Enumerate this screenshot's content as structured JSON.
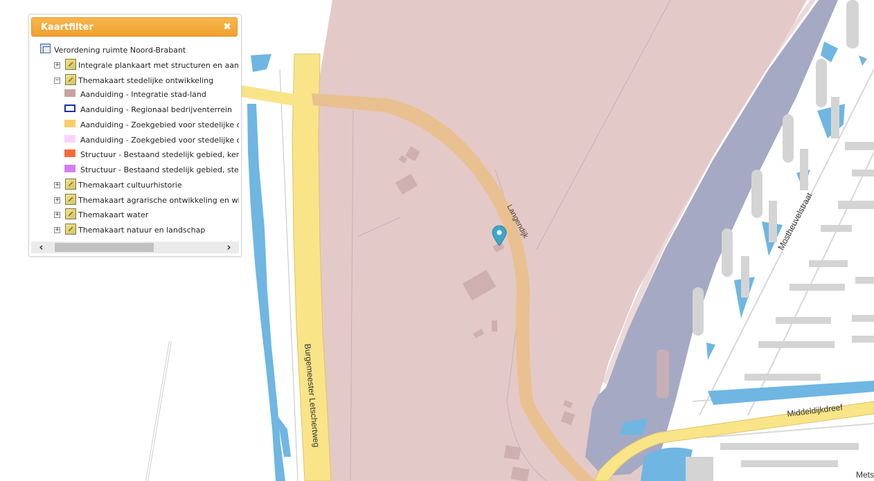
{
  "panel": {
    "title": "Kaartfilter",
    "close_glyph": "✖",
    "tree": {
      "root_label": "Verordening ruimte Noord-Brabant",
      "items": [
        {
          "label": "Integrale plankaart met structuren en aanduidingen",
          "expanded": false
        },
        {
          "label": "Themakaart stedelijke ontwikkeling",
          "expanded": true
        },
        {
          "label": "Themakaart cultuurhistorie",
          "expanded": false
        },
        {
          "label": "Themakaart agrarische ontwikkeling en windturbines",
          "expanded": false
        },
        {
          "label": "Themakaart water",
          "expanded": false
        },
        {
          "label": "Themakaart natuur en landschap",
          "expanded": false
        }
      ],
      "legend": [
        {
          "label": "Aanduiding - Integratie stad-land",
          "fill": "#c9a1a1",
          "stroke": "#c9a1a1"
        },
        {
          "label": "Aanduiding - Regionaal bedrijventerrein",
          "fill": "#ffffff",
          "stroke": "#1a2fb0"
        },
        {
          "label": "Aanduiding - Zoekgebied voor stedelijke ontwikkeling",
          "fill": "#f9cd6b",
          "stroke": "#f9cd6b"
        },
        {
          "label": "Aanduiding - Zoekgebied voor stedelijke ontwikkeling",
          "fill": "#fcd2fa",
          "stroke": "#fcd2fa"
        },
        {
          "label": "Structuur - Bestaand stedelijk gebied, kern in landelijk gebied",
          "fill": "#f76a3e",
          "stroke": "#f76a3e"
        },
        {
          "label": "Structuur - Bestaand stedelijk gebied, stedelijk concentratiegebied",
          "fill": "#d57ef2",
          "stroke": "#d57ef2"
        }
      ]
    },
    "scroll_left": "‹",
    "scroll_right": "›"
  },
  "map": {
    "streets": {
      "burgemeester": "Burgemeester Letschertweg",
      "langendijk": "Langendijk",
      "mostheuvelstraat": "Mostheuvelstraat",
      "middeldijkdreef": "Middeldijkdreef",
      "mets": "Mets"
    },
    "marker_icon": "map-pin-icon",
    "colors": {
      "zone_pink": "#e4c9c9",
      "road_yellow": "#f9e488",
      "road_orange": "#e9c08f",
      "water": "#6fb6e2",
      "dike": "#a5a9c4",
      "building": "#d4d4d4",
      "marker": "#3aa7c7"
    }
  }
}
